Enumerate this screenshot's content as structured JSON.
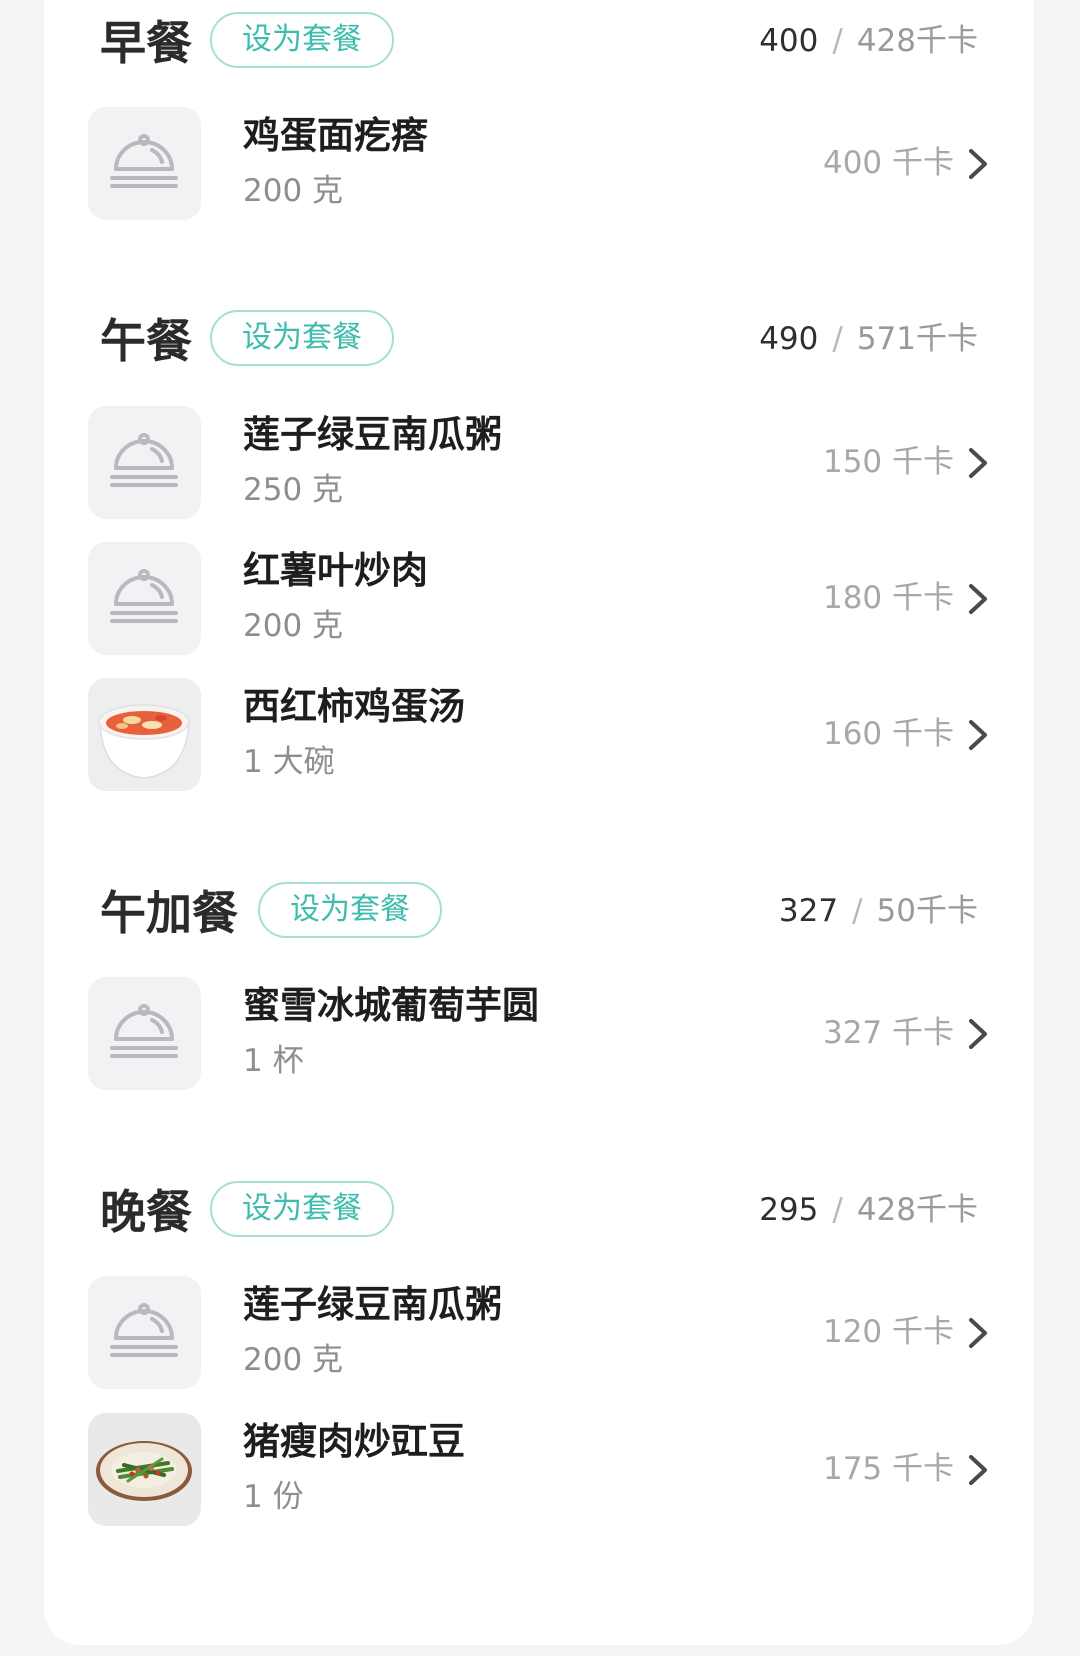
{
  "set_meal_label": "设为套餐",
  "kcal_unit": "千卡",
  "meals": [
    {
      "title": "早餐",
      "eaten": "400",
      "separator": "/",
      "target": "428千卡",
      "foods": [
        {
          "name": "鸡蛋面疙瘩",
          "amount": "200 克",
          "kcal": "400 千卡",
          "image": "dish-cover-icon"
        }
      ]
    },
    {
      "title": "午餐",
      "eaten": "490",
      "separator": "/",
      "target": "571千卡",
      "foods": [
        {
          "name": "莲子绿豆南瓜粥",
          "amount": "250 克",
          "kcal": "150 千卡",
          "image": "dish-cover-icon"
        },
        {
          "name": "红薯叶炒肉",
          "amount": "200 克",
          "kcal": "180 千卡",
          "image": "dish-cover-icon"
        },
        {
          "name": "西红柿鸡蛋汤",
          "amount": "1 大碗",
          "kcal": "160 千卡",
          "image": "tomato-egg-soup-photo"
        }
      ]
    },
    {
      "title": "午加餐",
      "eaten": "327",
      "separator": "/",
      "target": "50千卡",
      "foods": [
        {
          "name": "蜜雪冰城葡萄芋圆",
          "amount": "1 杯",
          "kcal": "327 千卡",
          "image": "dish-cover-icon"
        }
      ]
    },
    {
      "title": "晚餐",
      "eaten": "295",
      "separator": "/",
      "target": "428千卡",
      "foods": [
        {
          "name": "莲子绿豆南瓜粥",
          "amount": "200 克",
          "kcal": "120 千卡",
          "image": "dish-cover-icon"
        },
        {
          "name": "猪瘦肉炒豇豆",
          "amount": "1 份",
          "kcal": "175 千卡",
          "image": "stir-fried-beans-photo"
        }
      ]
    }
  ],
  "colors": {
    "accent": "#3dbdad",
    "accent_border": "#a6ddd6",
    "page_bg": "#f4f5f7",
    "card_bg": "#ffffff",
    "thumb_bg": "#f2f2f4"
  }
}
